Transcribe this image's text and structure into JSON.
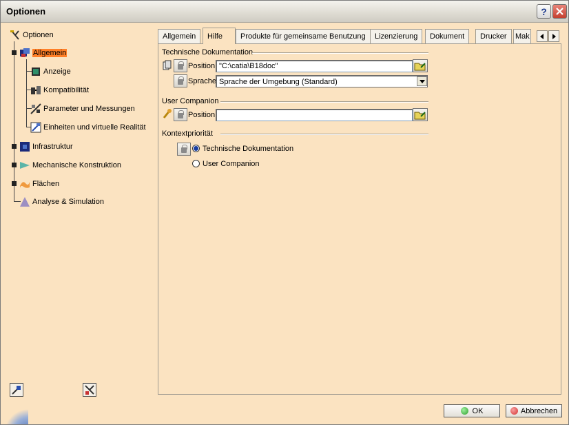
{
  "window": {
    "title": "Optionen",
    "help_glyph": "?",
    "close_glyph": "✕"
  },
  "tree": {
    "items": [
      {
        "label": "Optionen",
        "icon": "options-root-icon"
      },
      {
        "label": "Allgemein",
        "icon": "general-icon",
        "selected": true
      },
      {
        "label": "Anzeige",
        "icon": "display-icon"
      },
      {
        "label": "Kompatibilität",
        "icon": "compatibility-icon"
      },
      {
        "label": "Parameter und Messungen",
        "icon": "parameters-icon"
      },
      {
        "label": "Einheiten und virtuelle Realität",
        "icon": "units-icon"
      },
      {
        "label": "Infrastruktur",
        "icon": "infrastructure-icon"
      },
      {
        "label": "Mechanische Konstruktion",
        "icon": "mechanical-design-icon"
      },
      {
        "label": "Flächen",
        "icon": "surfaces-icon"
      },
      {
        "label": "Analyse & Simulation",
        "icon": "analysis-icon"
      }
    ]
  },
  "tabs": [
    {
      "label": "Allgemein"
    },
    {
      "label": "Hilfe",
      "active": true
    },
    {
      "label": "Produkte für gemeinsame Benutzung"
    },
    {
      "label": "Lizenzierung"
    },
    {
      "label": "Dokument"
    },
    {
      "label": "Drucker"
    },
    {
      "label": "Mak"
    }
  ],
  "tech_doc": {
    "group_title": "Technische Dokumentation",
    "position_label": "Position",
    "position_value": "\"C:\\catia\\B18doc\"",
    "language_label": "Sprache",
    "language_value": "Sprache der Umgebung (Standard)"
  },
  "user_companion": {
    "group_title": "User Companion",
    "position_label": "Position",
    "position_value": ""
  },
  "priority": {
    "group_title": "Kontextpriorität",
    "options": [
      {
        "label": "Technische Dokumentation",
        "checked": true
      },
      {
        "label": "User Companion",
        "checked": false
      }
    ]
  },
  "footer": {
    "ok_label": "OK",
    "cancel_label": "Abbrechen"
  },
  "colors": {
    "panel_bg": "#fbe3c1",
    "selection": "#ff7f27",
    "ok_dot": "#2e9e2e",
    "cancel_dot": "#d43030"
  }
}
